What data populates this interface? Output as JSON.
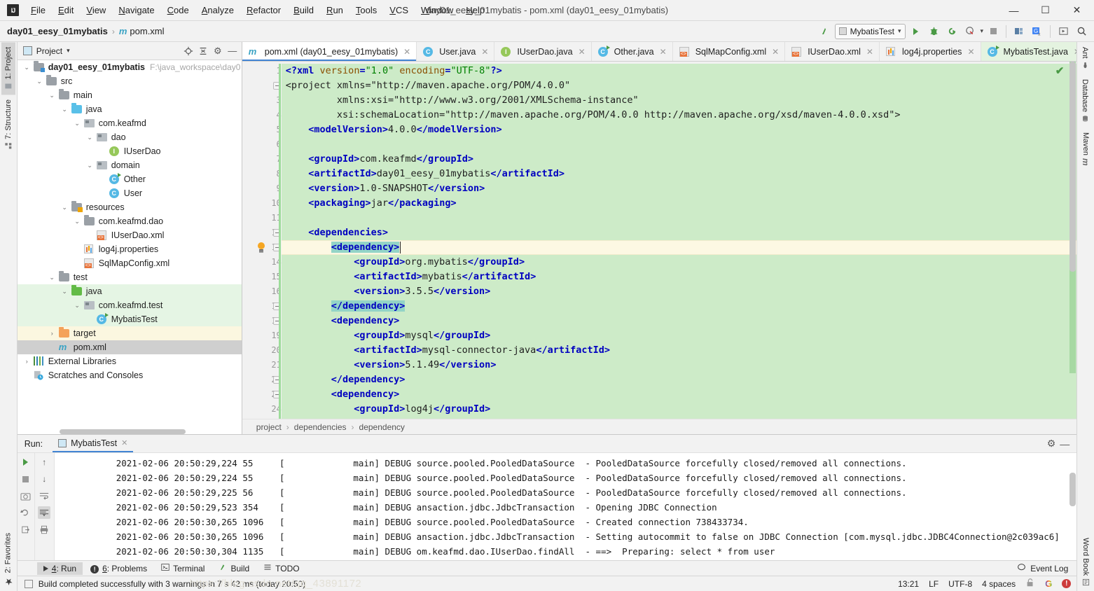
{
  "window": {
    "title": "day01_eesy_01mybatis - pom.xml (day01_eesy_01mybatis)",
    "minimize": "—",
    "maximize": "☐",
    "close": "✕",
    "logo": "IJ"
  },
  "menu": [
    "File",
    "Edit",
    "View",
    "Navigate",
    "Code",
    "Analyze",
    "Refactor",
    "Build",
    "Run",
    "Tools",
    "VCS",
    "Window",
    "Help"
  ],
  "navbar": {
    "project": "day01_eesy_01mybatis",
    "separator": "›",
    "file": "pom.xml",
    "maven_glyph": "m",
    "run_config": "MybatisTest",
    "dropdown_caret": "▾"
  },
  "left_rail": [
    {
      "label": "1: Project",
      "icon": "project-icon",
      "active": true
    },
    {
      "label": "7: Structure",
      "icon": "structure-icon",
      "active": false
    }
  ],
  "left_rail_bottom": [
    {
      "label": "2: Favorites",
      "icon": "star-icon"
    }
  ],
  "right_rail": [
    {
      "label": "Ant",
      "icon": "ant-icon"
    },
    {
      "label": "Database",
      "icon": "database-icon"
    },
    {
      "label": "Maven",
      "icon": "maven-icon"
    }
  ],
  "right_rail_bottom": [
    {
      "label": "Word Book",
      "icon": "book-icon"
    }
  ],
  "project_panel": {
    "title": "Project",
    "caret": "▾",
    "icons": [
      "locate-icon",
      "collapse-all-icon",
      "gear-icon",
      "hide-icon"
    ],
    "tree": [
      {
        "depth": 0,
        "arrow": "⌄",
        "icon": "folder-module",
        "label": "day01_eesy_01mybatis",
        "bold": true,
        "path": "F:\\java_workspace\\day0",
        "state": "none"
      },
      {
        "depth": 1,
        "arrow": "⌄",
        "icon": "folder-gray",
        "label": "src",
        "state": "none"
      },
      {
        "depth": 2,
        "arrow": "⌄",
        "icon": "folder-gray",
        "label": "main",
        "state": "none"
      },
      {
        "depth": 3,
        "arrow": "⌄",
        "icon": "folder-blue",
        "label": "java",
        "state": "none"
      },
      {
        "depth": 4,
        "arrow": "⌄",
        "icon": "package",
        "label": "com.keafmd",
        "state": "none"
      },
      {
        "depth": 5,
        "arrow": "⌄",
        "icon": "package",
        "label": "dao",
        "state": "none"
      },
      {
        "depth": 6,
        "arrow": "",
        "icon": "interface",
        "label": "IUserDao",
        "state": "none"
      },
      {
        "depth": 5,
        "arrow": "⌄",
        "icon": "package",
        "label": "domain",
        "state": "none"
      },
      {
        "depth": 6,
        "arrow": "",
        "icon": "class-run",
        "label": "Other",
        "state": "none"
      },
      {
        "depth": 6,
        "arrow": "",
        "icon": "class",
        "label": "User",
        "state": "none"
      },
      {
        "depth": 3,
        "arrow": "⌄",
        "icon": "folder-resources",
        "label": "resources",
        "state": "none"
      },
      {
        "depth": 4,
        "arrow": "⌄",
        "icon": "folder-gray",
        "label": "com.keafmd.dao",
        "state": "none"
      },
      {
        "depth": 5,
        "arrow": "",
        "icon": "xml",
        "label": "IUserDao.xml",
        "state": "none"
      },
      {
        "depth": 4,
        "arrow": "",
        "icon": "properties",
        "label": "log4j.properties",
        "state": "none"
      },
      {
        "depth": 4,
        "arrow": "",
        "icon": "xml",
        "label": "SqlMapConfig.xml",
        "state": "none"
      },
      {
        "depth": 2,
        "arrow": "⌄",
        "icon": "folder-gray",
        "label": "test",
        "state": "none"
      },
      {
        "depth": 3,
        "arrow": "⌄",
        "icon": "folder-green",
        "label": "java",
        "state": "green"
      },
      {
        "depth": 4,
        "arrow": "⌄",
        "icon": "package",
        "label": "com.keafmd.test",
        "state": "green"
      },
      {
        "depth": 5,
        "arrow": "",
        "icon": "class-run",
        "label": "MybatisTest",
        "state": "green"
      },
      {
        "depth": 2,
        "arrow": "›",
        "icon": "folder-orange",
        "label": "target",
        "state": "yellow"
      },
      {
        "depth": 2,
        "arrow": "",
        "icon": "maven",
        "label": "pom.xml",
        "state": "selected"
      },
      {
        "depth": 0,
        "arrow": "›",
        "icon": "libraries",
        "label": "External Libraries",
        "state": "none"
      },
      {
        "depth": 0,
        "arrow": "",
        "icon": "scratches",
        "label": "Scratches and Consoles",
        "state": "none"
      }
    ]
  },
  "editor": {
    "tabs": [
      {
        "label": "pom.xml (day01_eesy_01mybatis)",
        "icon": "maven",
        "active": true,
        "close": "✕"
      },
      {
        "label": "User.java",
        "icon": "class",
        "active": false,
        "close": "✕"
      },
      {
        "label": "IUserDao.java",
        "icon": "interface",
        "active": false,
        "close": "✕"
      },
      {
        "label": "Other.java",
        "icon": "class-run",
        "active": false,
        "close": "✕"
      },
      {
        "label": "SqlMapConfig.xml",
        "icon": "xml",
        "active": false,
        "close": "✕"
      },
      {
        "label": "IUserDao.xml",
        "icon": "xml",
        "active": false,
        "close": "✕"
      },
      {
        "label": "log4j.properties",
        "icon": "properties",
        "active": false,
        "close": "✕"
      },
      {
        "label": "MybatisTest.java",
        "icon": "class-run",
        "active": false,
        "green": true,
        "close": "✕"
      }
    ],
    "checkmark": "✔",
    "caret_line": 13,
    "lines": [
      {
        "n": 1,
        "indent": 0,
        "html": "<?xml version=\"1.0\" encoding=\"UTF-8\"?>"
      },
      {
        "n": 2,
        "indent": 0,
        "html": "<project xmlns=\"http://maven.apache.org/POM/4.0.0\""
      },
      {
        "n": 3,
        "indent": 9,
        "html": "xmlns:xsi=\"http://www.w3.org/2001/XMLSchema-instance\""
      },
      {
        "n": 4,
        "indent": 9,
        "html": "xsi:schemaLocation=\"http://maven.apache.org/POM/4.0.0 http://maven.apache.org/xsd/maven-4.0.0.xsd\">"
      },
      {
        "n": 5,
        "indent": 4,
        "html": "<modelVersion>4.0.0</modelVersion>"
      },
      {
        "n": 6,
        "indent": 0,
        "html": ""
      },
      {
        "n": 7,
        "indent": 4,
        "html": "<groupId>com.keafmd</groupId>"
      },
      {
        "n": 8,
        "indent": 4,
        "html": "<artifactId>day01_eesy_01mybatis</artifactId>"
      },
      {
        "n": 9,
        "indent": 4,
        "html": "<version>1.0-SNAPSHOT</version>"
      },
      {
        "n": 10,
        "indent": 4,
        "html": "<packaging>jar</packaging>"
      },
      {
        "n": 11,
        "indent": 0,
        "html": ""
      },
      {
        "n": 12,
        "indent": 4,
        "html": "<dependencies>"
      },
      {
        "n": 13,
        "indent": 8,
        "html": "<dependency>"
      },
      {
        "n": 14,
        "indent": 12,
        "html": "<groupId>org.mybatis</groupId>"
      },
      {
        "n": 15,
        "indent": 12,
        "html": "<artifactId>mybatis</artifactId>"
      },
      {
        "n": 16,
        "indent": 12,
        "html": "<version>3.5.5</version>"
      },
      {
        "n": 17,
        "indent": 8,
        "html": "</dependency>"
      },
      {
        "n": 18,
        "indent": 8,
        "html": "<dependency>"
      },
      {
        "n": 19,
        "indent": 12,
        "html": "<groupId>mysql</groupId>"
      },
      {
        "n": 20,
        "indent": 12,
        "html": "<artifactId>mysql-connector-java</artifactId>"
      },
      {
        "n": 21,
        "indent": 12,
        "html": "<version>5.1.49</version>"
      },
      {
        "n": 22,
        "indent": 8,
        "html": "</dependency>"
      },
      {
        "n": 23,
        "indent": 8,
        "html": "<dependency>"
      },
      {
        "n": 24,
        "indent": 12,
        "html": "<groupId>log4j</groupId>"
      }
    ],
    "breadcrumbs": [
      "project",
      "dependencies",
      "dependency"
    ],
    "breadcrumb_sep": "›"
  },
  "run_panel": {
    "label": "Run:",
    "tab": "MybatisTest",
    "tab_close": "✕",
    "header_icons": [
      "gear-icon",
      "hide-icon"
    ],
    "tool_icons_left": [
      "run-icon",
      "stop-icon",
      "camera-icon",
      "rerun-failed-icon",
      "export-icon"
    ],
    "tool_icons_right": [
      "scroll-up-icon",
      "scroll-down-icon",
      "soft-wrap-icon",
      "scroll-to-end-icon",
      "print-icon"
    ],
    "log": [
      {
        "ts": "2021-02-06 20:50:29,224",
        "ms": "55",
        "thread": "main]",
        "level": "DEBUG",
        "logger": "source.pooled.PooledDataSource",
        "msg": "- PooledDataSource forcefully closed/removed all connections."
      },
      {
        "ts": "2021-02-06 20:50:29,224",
        "ms": "55",
        "thread": "main]",
        "level": "DEBUG",
        "logger": "source.pooled.PooledDataSource",
        "msg": "- PooledDataSource forcefully closed/removed all connections."
      },
      {
        "ts": "2021-02-06 20:50:29,225",
        "ms": "56",
        "thread": "main]",
        "level": "DEBUG",
        "logger": "source.pooled.PooledDataSource",
        "msg": "- PooledDataSource forcefully closed/removed all connections."
      },
      {
        "ts": "2021-02-06 20:50:29,523",
        "ms": "354",
        "thread": "main]",
        "level": "DEBUG",
        "logger": "ansaction.jdbc.JdbcTransaction",
        "msg": "- Opening JDBC Connection"
      },
      {
        "ts": "2021-02-06 20:50:30,265",
        "ms": "1096",
        "thread": "main]",
        "level": "DEBUG",
        "logger": "source.pooled.PooledDataSource",
        "msg": "- Created connection 738433734."
      },
      {
        "ts": "2021-02-06 20:50:30,265",
        "ms": "1096",
        "thread": "main]",
        "level": "DEBUG",
        "logger": "ansaction.jdbc.JdbcTransaction",
        "msg": "- Setting autocommit to false on JDBC Connection [com.mysql.jdbc.JDBC4Connection@2c039ac6]"
      },
      {
        "ts": "2021-02-06 20:50:30,304",
        "ms": "1135",
        "thread": "main]",
        "level": "DEBUG",
        "logger": "om.keafmd.dao.IUserDao.findAll",
        "msg": "- ==>  Preparing: select * from user"
      }
    ],
    "bracket": "["
  },
  "toolwindow_bar": {
    "items": [
      {
        "label": "4: Run",
        "icon": "run-icon",
        "active": true
      },
      {
        "label": "6: Problems",
        "icon": "problems-icon",
        "active": false
      },
      {
        "label": "Terminal",
        "icon": "terminal-icon",
        "active": false
      },
      {
        "label": "Build",
        "icon": "build-icon",
        "active": false
      },
      {
        "label": "TODO",
        "icon": "todo-icon",
        "active": false
      }
    ],
    "event_log": "Event Log",
    "event_log_icon": "balloon-icon"
  },
  "statusbar": {
    "message": "Build completed successfully with 3 warnings in 7 s 42 ms (today 20:50)",
    "message_icon": "build-status-icon",
    "caret_position": "13:21",
    "line_separator": "LF",
    "encoding": "UTF-8",
    "indent": "4 spaces",
    "lock_icon": "unlock-icon",
    "google_icon": "G",
    "error_icon": "!",
    "watermark": "https://blog.csdn.net/qq_43891172"
  }
}
